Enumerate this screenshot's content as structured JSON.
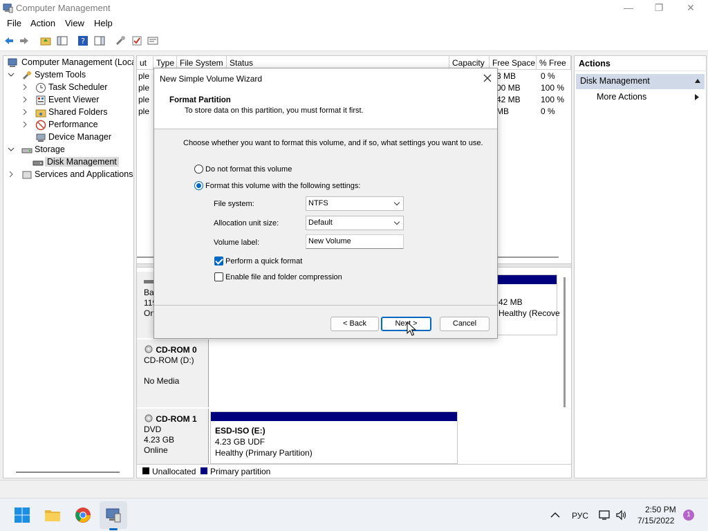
{
  "window": {
    "title": "Computer Management",
    "minimize": "—",
    "restore": "❐",
    "close": "✕"
  },
  "menu": [
    "File",
    "Action",
    "View",
    "Help"
  ],
  "tree": {
    "root": "Computer Management (Local",
    "system_tools": "System Tools",
    "task_scheduler": "Task Scheduler",
    "event_viewer": "Event Viewer",
    "shared_folders": "Shared Folders",
    "performance": "Performance",
    "device_manager": "Device Manager",
    "storage": "Storage",
    "disk_management": "Disk Management",
    "services": "Services and Applications"
  },
  "volume_table": {
    "headers": [
      "ut",
      "Type",
      "File System",
      "Status",
      "Capacity",
      "Free Space",
      "% Free"
    ],
    "col_frag": [
      "ple",
      "ple",
      "ple",
      "ple"
    ],
    "free_space": [
      "3 MB",
      "00 MB",
      "42 MB",
      "MB"
    ],
    "pct_free": [
      "0 %",
      "100 %",
      "100 %",
      "0 %"
    ]
  },
  "disks": {
    "disk0_frag1": "Ba",
    "disk0_frag2": "119",
    "disk0_frag3": "On",
    "disk0_part_size": "42 MB",
    "disk0_part_status": "Healthy (Recove",
    "cdrom0": {
      "name": "CD-ROM 0",
      "type": "CD-ROM (D:)",
      "status": "No Media"
    },
    "cdrom1": {
      "name": "CD-ROM 1",
      "type": "DVD",
      "size": "4.23 GB",
      "status": "Online",
      "volume": "ESD-ISO  (E:)",
      "volume_size": "4.23 GB UDF",
      "volume_status": "Healthy (Primary Partition)"
    }
  },
  "legend": {
    "unallocated": "Unallocated",
    "primary": "Primary partition"
  },
  "actions": {
    "heading": "Actions",
    "section": "Disk Management",
    "more": "More Actions"
  },
  "wizard": {
    "title": "New Simple Volume Wizard",
    "heading": "Format Partition",
    "subheading": "To store data on this partition, you must format it first.",
    "instruction": "Choose whether you want to format this volume, and if so, what settings you want to use.",
    "opt_no_format": "Do not format this volume",
    "opt_format": "Format this volume with the following settings:",
    "fs_label": "File system:",
    "fs_value": "NTFS",
    "alloc_label": "Allocation unit size:",
    "alloc_value": "Default",
    "vol_label": "Volume label:",
    "vol_value": "New Volume",
    "quick_format": "Perform a quick format",
    "compression": "Enable file and folder compression",
    "back": "< Back",
    "next": "Next >",
    "cancel": "Cancel"
  },
  "taskbar": {
    "lang": "РУС",
    "time": "2:50 PM",
    "date": "7/15/2022",
    "notif_count": "1"
  },
  "colors": {
    "primary_partition": "#00007e",
    "accent": "#0067c0",
    "actions_section": "#cfd9e8"
  }
}
